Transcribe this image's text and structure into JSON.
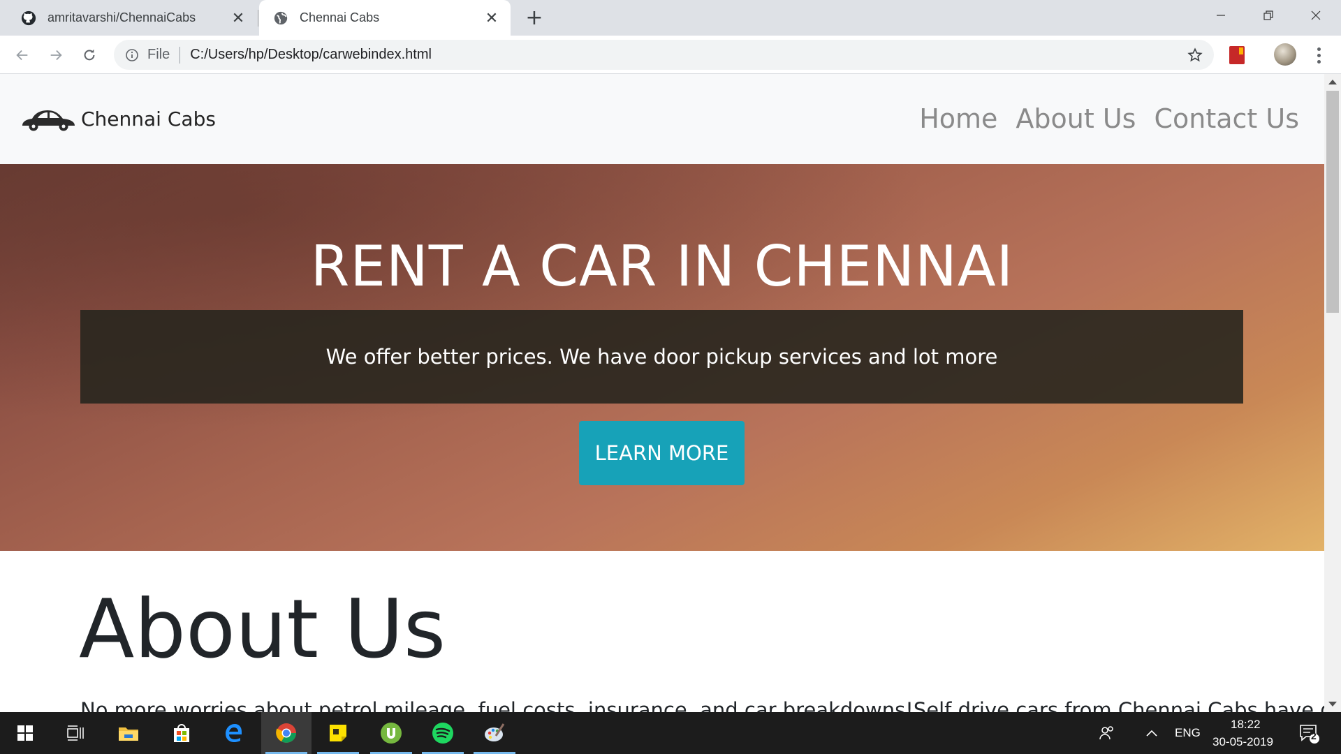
{
  "browser": {
    "tabs": [
      {
        "title": "amritavarshi/ChennaiCabs",
        "favicon": "github-icon",
        "active": false
      },
      {
        "title": "Chennai Cabs",
        "favicon": "globe-icon",
        "active": true
      }
    ],
    "address": {
      "scheme_label": "File",
      "url": "C:/Users/hp/Desktop/carwebindex.html"
    }
  },
  "site": {
    "brand": "Chennai Cabs",
    "nav": [
      "Home",
      "About Us",
      "Contact Us"
    ],
    "hero": {
      "title": "RENT A CAR IN CHENNAI",
      "subtitle": "We offer better prices. We have door pickup services and lot more",
      "button": "LEARN MORE"
    },
    "about": {
      "title": "About Us",
      "text": "No more worries about petrol mileage, fuel costs, insurance, and car breakdowns!Self drive cars from Chennai Cabs have given"
    }
  },
  "taskbar": {
    "language": "ENG",
    "time": "18:22",
    "date": "30-05-2019",
    "notifications": "2"
  },
  "colors": {
    "accent_button": "#17a2b8",
    "tab_bar": "#dee1e6",
    "taskbar": "#1c1c1c"
  }
}
